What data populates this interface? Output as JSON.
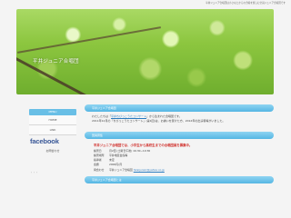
{
  "top_note": "平井ジュニア合唱団は小さなとからの合唱を楽しむ全員ジュニア合唱団です",
  "site": {
    "title": "平井ジュニア合唱団"
  },
  "sidebar": {
    "menu_head": "MENU",
    "items": [
      {
        "label": "HOME"
      },
      {
        "label": "LINK"
      }
    ],
    "facebook": "facebook",
    "facebook_sub": "お問合わせ",
    "dots": "・・・"
  },
  "main": {
    "section1": {
      "title": "平井ジュニア合唱団",
      "line1_pre": "わたしたちは「",
      "line1_link": "平井ちびっこうたコンサート",
      "line1_post": "」から生まれた合唱団です。",
      "line2": "2011年12月の「ちびっこうたコンサート」(第1回)は、お誘いを受けた方、2012年の出演者等がいました。"
    },
    "section2": {
      "title": "団員募集",
      "highlight": "平井ジュニア合唱団では、小学生から高校生までの合唱団員を募集中。",
      "info": [
        {
          "k": "練習日",
          "v": "月2回 (土曜日午後)  16:30~19:30"
        },
        {
          "k": "練習場所",
          "v": "平井地区会館等"
        },
        {
          "k": "指導者",
          "v": "未定"
        },
        {
          "k": "会費",
          "v": "2000円/月"
        },
        {
          "k": "問合わせ",
          "v": "平井ジュニア合唱団"
        }
      ],
      "email": "hiraijunior@yahoo.co.jp"
    },
    "section3": {
      "title": "平井ジュニア合唱団とは"
    }
  }
}
